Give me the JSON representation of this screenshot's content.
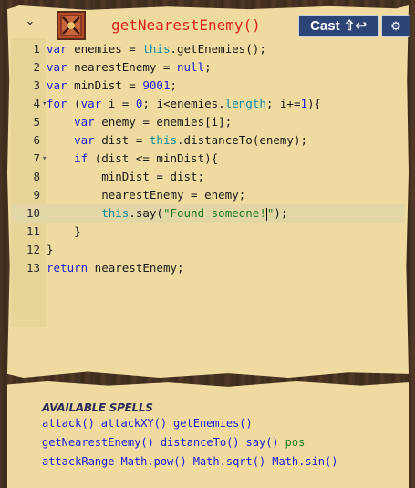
{
  "header": {
    "title": "getNearestEnemy()",
    "cast_label": "Cast ⇧↩",
    "gear_icon": "gear-icon",
    "chevron_icon": "chevron-down-icon",
    "spell_icon": "crossed-spell-icon"
  },
  "editor": {
    "active_line": 10,
    "lines": [
      {
        "n": "1",
        "fold": "",
        "tokens": [
          [
            "kw",
            "var"
          ],
          [
            "op",
            " enemies = "
          ],
          [
            "prop",
            "this"
          ],
          [
            "op",
            ".getEnemies();"
          ]
        ]
      },
      {
        "n": "2",
        "fold": "",
        "tokens": [
          [
            "kw",
            "var"
          ],
          [
            "op",
            " nearestEnemy = "
          ],
          [
            "kw",
            "null"
          ],
          [
            "op",
            ";"
          ]
        ]
      },
      {
        "n": "3",
        "fold": "",
        "tokens": [
          [
            "kw",
            "var"
          ],
          [
            "op",
            " minDist = "
          ],
          [
            "num",
            "9001"
          ],
          [
            "op",
            ";"
          ]
        ]
      },
      {
        "n": "4",
        "fold": "▾",
        "tokens": [
          [
            "kw",
            "for"
          ],
          [
            "op",
            " ("
          ],
          [
            "kw",
            "var"
          ],
          [
            "op",
            " i = "
          ],
          [
            "num",
            "0"
          ],
          [
            "op",
            "; i<enemies."
          ],
          [
            "prop",
            "length"
          ],
          [
            "op",
            "; i+="
          ],
          [
            "num",
            "1"
          ],
          [
            "op",
            "){"
          ]
        ]
      },
      {
        "n": "5",
        "fold": "",
        "tokens": [
          [
            "op",
            "    "
          ],
          [
            "kw",
            "var"
          ],
          [
            "op",
            " enemy = enemies[i];"
          ]
        ]
      },
      {
        "n": "6",
        "fold": "",
        "tokens": [
          [
            "op",
            "    "
          ],
          [
            "kw",
            "var"
          ],
          [
            "op",
            " dist = "
          ],
          [
            "prop",
            "this"
          ],
          [
            "op",
            ".distanceTo(enemy);"
          ]
        ]
      },
      {
        "n": "7",
        "fold": "▾",
        "tokens": [
          [
            "op",
            "    "
          ],
          [
            "kw",
            "if"
          ],
          [
            "op",
            " (dist <= minDist){"
          ]
        ]
      },
      {
        "n": "8",
        "fold": "",
        "tokens": [
          [
            "op",
            "        minDist = dist;"
          ]
        ]
      },
      {
        "n": "9",
        "fold": "",
        "tokens": [
          [
            "op",
            "        nearestEnemy = enemy;"
          ]
        ]
      },
      {
        "n": "10",
        "fold": "",
        "tokens": [
          [
            "op",
            "        "
          ],
          [
            "prop",
            "this"
          ],
          [
            "op",
            ".say("
          ],
          [
            "str",
            "\"Found someone!"
          ],
          [
            "cursor",
            ""
          ],
          [
            "str",
            "\""
          ],
          [
            "op",
            ");"
          ]
        ]
      },
      {
        "n": "11",
        "fold": "",
        "tokens": [
          [
            "op",
            "    }"
          ]
        ]
      },
      {
        "n": "12",
        "fold": "",
        "tokens": [
          [
            "op",
            "}"
          ]
        ]
      },
      {
        "n": "13",
        "fold": "",
        "tokens": [
          [
            "kw",
            "return"
          ],
          [
            "op",
            " nearestEnemy;"
          ]
        ]
      }
    ]
  },
  "spells": {
    "title": "AVAILABLE SPELLS",
    "rows": [
      [
        {
          "label": "attack()",
          "color": "blue"
        },
        {
          "label": "attackXY()",
          "color": "blue"
        },
        {
          "label": "getEnemies()",
          "color": "blue"
        }
      ],
      [
        {
          "label": "getNearestEnemy()",
          "color": "blue"
        },
        {
          "label": "distanceTo()",
          "color": "blue"
        },
        {
          "label": "say()",
          "color": "blue"
        },
        {
          "label": "pos",
          "color": "green"
        }
      ],
      [
        {
          "label": "attackRange",
          "color": "blue"
        },
        {
          "label": "Math.pow()",
          "color": "blue"
        },
        {
          "label": "Math.sqrt()",
          "color": "blue"
        },
        {
          "label": "Math.sin()",
          "color": "blue"
        }
      ]
    ]
  }
}
